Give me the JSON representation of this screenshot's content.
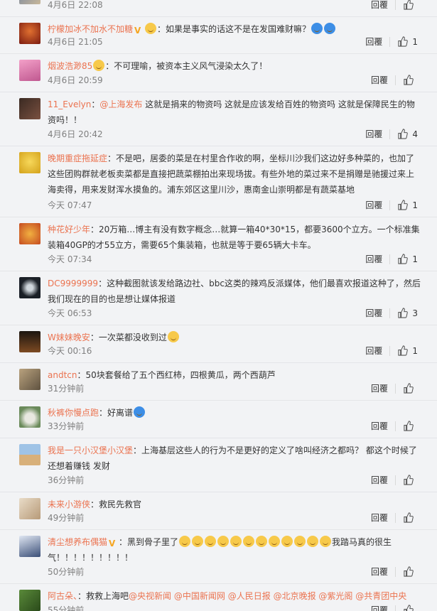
{
  "comments": [
    {
      "user": "",
      "text": "",
      "time": "4月6日 22:08",
      "reply": "回覆",
      "likes": ""
    },
    {
      "user": "柠檬加冰不加水不加糖",
      "text": "如果是事实的话这不是在发国难财嘛？",
      "time": "4月6日 21:05",
      "reply": "回覆",
      "likes": "1"
    },
    {
      "user": "烟波浩渺85",
      "text": "不可理喻，被资本主义风气浸染太久了！",
      "time": "4月6日 20:59",
      "reply": "回覆",
      "likes": ""
    },
    {
      "user": "11_Evelyn",
      "mention": "@上海发布",
      "text": " 这就是捐来的物资吗 这就是应该发给百姓的物资吗 这就是保障民生的物资吗！！",
      "time": "4月6日 20:42",
      "reply": "回覆",
      "likes": "4"
    },
    {
      "user": "晚期重症拖延症",
      "text": "不是吧，居委的菜是在村里合作收的啊，坐标川沙我们这边好多种菜的，也加了这些团购群就老板卖菜都是直接把蔬菜棚拍出来现场拔。有些外地的菜过来不是捐赠是驰援过来上海卖得，用来发财浑水摸鱼的。浦东郊区这里川沙，惠南金山崇明都是有蔬菜基地",
      "time": "今天 07:47",
      "reply": "回覆",
      "likes": "1"
    },
    {
      "user": "种花好少年",
      "text": "20万箱…博主有没有数字概念…就算一箱40*30*15，都要3600个立方。一个标准集装箱40GP的才55立方，需要65个集装箱，也就是等于要65辆大卡车。",
      "time": "今天 07:34",
      "reply": "回覆",
      "likes": "1"
    },
    {
      "user": "DC9999999",
      "text": "这种截图就该发给路边社、bbc这类的辣鸡反派媒体，他们最喜欢报道这种了，然后我们现在的目的也是想让媒体报道",
      "time": "今天 06:53",
      "reply": "回覆",
      "likes": "3"
    },
    {
      "user": "W妹妹晚安",
      "text": "一次菜都没收到过",
      "time": "今天 00:16",
      "reply": "回覆",
      "likes": "1"
    },
    {
      "user": "andtcn",
      "text": "50块套餐给了五个西红柿，四根黄瓜，两个西葫芦",
      "time": "31分钟前",
      "reply": "回覆",
      "likes": ""
    },
    {
      "user": "秋裤你慢点跑",
      "text": "好离谱",
      "time": "33分钟前",
      "reply": "回覆",
      "likes": ""
    },
    {
      "user": "我是一只小汉堡小汉堡",
      "text": "上海基层这些人的行为不是更好的定义了啥叫经济之都吗？ 都这个时候了还想着赚钱 发财",
      "time": "36分钟前",
      "reply": "回覆",
      "likes": ""
    },
    {
      "user": "未来小游侠",
      "text": "救民先救官",
      "time": "49分钟前",
      "reply": "回覆",
      "likes": ""
    },
    {
      "user": "清尘想养布偶猫",
      "text": "黑到骨子里了",
      "text2": "我踏马真的很生气！！！！！！！！！",
      "time": "50分钟前",
      "reply": "回覆",
      "likes": ""
    },
    {
      "user": "阿古朵、",
      "text": "救救上海吧@央视新闻 @中国新闻网 @人民日报 @北京晚报 @紫光阁 @共青团中央",
      "time": "55分钟前",
      "reply": "回覆",
      "likes": ""
    }
  ]
}
